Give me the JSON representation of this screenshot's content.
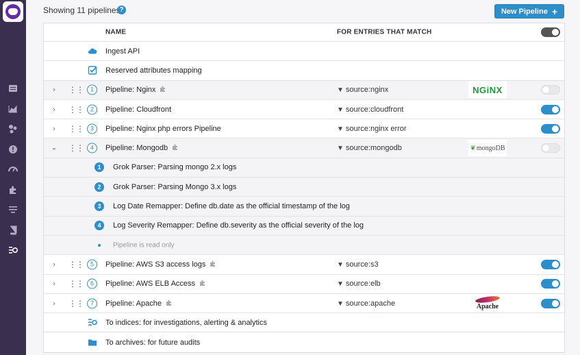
{
  "header": {
    "count_text": "Showing 11 pipelines",
    "help_glyph": "?",
    "new_button_label": "New Pipeline",
    "new_button_plus": "+"
  },
  "columns": {
    "name": "NAME",
    "match": "FOR ENTRIES THAT MATCH"
  },
  "rows": {
    "ingest": {
      "label": "Ingest API"
    },
    "reserved": {
      "label": "Reserved attributes mapping"
    },
    "p1": {
      "num": "1",
      "label": "Pipeline: Nginx",
      "filter": "source:nginx",
      "logo": "NGiNX",
      "enabled": false
    },
    "p2": {
      "num": "2",
      "label": "Pipeline: Cloudfront",
      "filter": "source:cloudfront",
      "enabled": true
    },
    "p3": {
      "num": "3",
      "label": "Pipeline: Nginx php errors Pipeline",
      "filter": "source:nginx error",
      "enabled": true
    },
    "p4": {
      "num": "4",
      "label": "Pipeline: Mongodb",
      "filter": "source:mongodb",
      "logo": "mongoDB",
      "enabled": false
    },
    "p5": {
      "num": "5",
      "label": "Pipeline: AWS S3 access logs",
      "filter": "source:s3",
      "enabled": true
    },
    "p6": {
      "num": "6",
      "label": "Pipeline: AWS ELB Access",
      "filter": "source:elb",
      "enabled": true
    },
    "p7": {
      "num": "7",
      "label": "Pipeline: Apache",
      "filter": "source:apache",
      "logo": "Apache",
      "enabled": true
    },
    "indices": {
      "label": "To indices: for investigations, alerting & analytics"
    },
    "archives": {
      "label": "To archives: for future audits"
    }
  },
  "processors": [
    {
      "num": "1",
      "label": "Grok Parser: Parsing mongo 2.x logs"
    },
    {
      "num": "2",
      "label": "Grok Parser: Parsing Mongo 3.x logs"
    },
    {
      "num": "3",
      "label": "Log Date Remapper: Define db.date as the official timestamp of the log"
    },
    {
      "num": "4",
      "label": "Log Severity Remapper: Define db.severity as the official severity of the log"
    }
  ],
  "readonly_note": "Pipeline is read only",
  "colors": {
    "accent": "#2e8ec9",
    "sidebar": "#3a2f4f",
    "nginx": "#1a9a3a"
  },
  "icons": {
    "sidebar": [
      "list-icon",
      "chart-icon",
      "hexagon-nodes-icon",
      "alert-icon",
      "gauge-icon",
      "puzzle-icon",
      "filter-lines-icon",
      "book-icon",
      "logs-icon"
    ],
    "rows": [
      "cloud-icon",
      "checkbox-icon",
      "indices-icon",
      "folder-icon"
    ]
  }
}
